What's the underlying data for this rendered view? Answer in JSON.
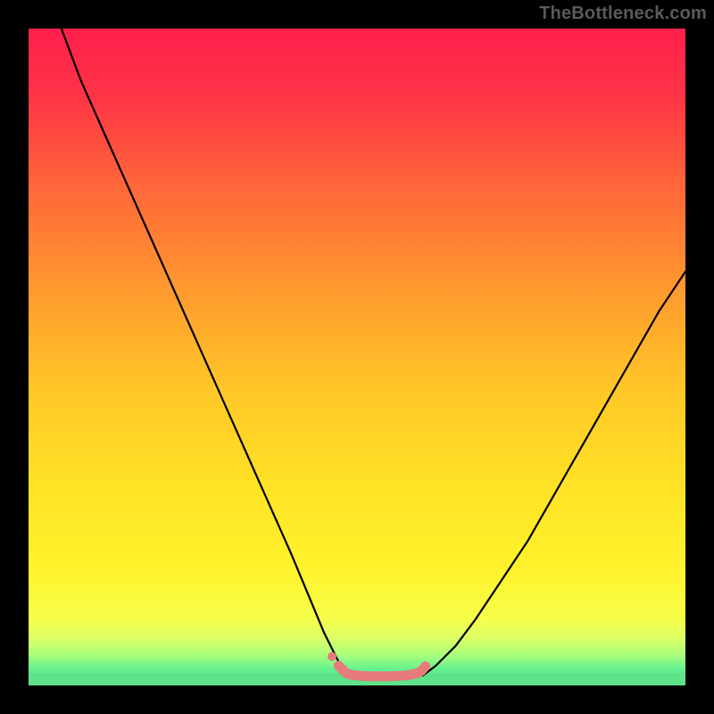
{
  "watermark": "TheBottleneck.com",
  "colors": {
    "frame": "#000000",
    "curve": "#000000",
    "flat_band": "#5fe38a",
    "marker": "#e77b7b",
    "gradient_stops": [
      {
        "offset": 0.0,
        "color": "#ff1f4b"
      },
      {
        "offset": 0.1,
        "color": "#ff3346"
      },
      {
        "offset": 0.25,
        "color": "#ff6a39"
      },
      {
        "offset": 0.4,
        "color": "#ff9a2e"
      },
      {
        "offset": 0.55,
        "color": "#ffc727"
      },
      {
        "offset": 0.7,
        "color": "#ffe326"
      },
      {
        "offset": 0.82,
        "color": "#fff22a"
      },
      {
        "offset": 0.9,
        "color": "#f6ff4a"
      },
      {
        "offset": 0.93,
        "color": "#d9ff66"
      },
      {
        "offset": 0.955,
        "color": "#a6ff7e"
      },
      {
        "offset": 0.975,
        "color": "#66f08e"
      },
      {
        "offset": 1.0,
        "color": "#47e38f"
      }
    ]
  },
  "chart_data": {
    "type": "line",
    "title": "",
    "xlabel": "",
    "ylabel": "",
    "xlim": [
      0,
      100
    ],
    "ylim": [
      0,
      100
    ],
    "series": [
      {
        "name": "left-curve",
        "x": [
          5,
          8,
          12,
          16,
          20,
          24,
          28,
          32,
          36,
          40,
          42.5,
          45,
          47,
          48.5
        ],
        "y": [
          100,
          92,
          83,
          74,
          65,
          56,
          47,
          38,
          29,
          20,
          14,
          8,
          4,
          1.5
        ]
      },
      {
        "name": "right-curve",
        "x": [
          60,
          62,
          65,
          68,
          72,
          76,
          80,
          84,
          88,
          92,
          96,
          100
        ],
        "y": [
          1.5,
          3,
          6,
          10,
          16,
          22,
          29,
          36,
          43,
          50,
          57,
          63
        ]
      },
      {
        "name": "flat-bottom",
        "x": [
          48.5,
          60
        ],
        "y": [
          1.5,
          1.5
        ]
      }
    ],
    "markers": {
      "name": "bottom-dots",
      "x": [
        47.2,
        48.3,
        49.2,
        50.1,
        51.0,
        52.0,
        53.0,
        54.0,
        55.0,
        56.0,
        57.0,
        58.0,
        59.0,
        59.8,
        60.4
      ],
      "y": [
        3.0,
        1.9,
        1.6,
        1.5,
        1.45,
        1.4,
        1.4,
        1.4,
        1.4,
        1.45,
        1.5,
        1.6,
        1.8,
        2.2,
        2.9
      ]
    },
    "annotations": []
  }
}
